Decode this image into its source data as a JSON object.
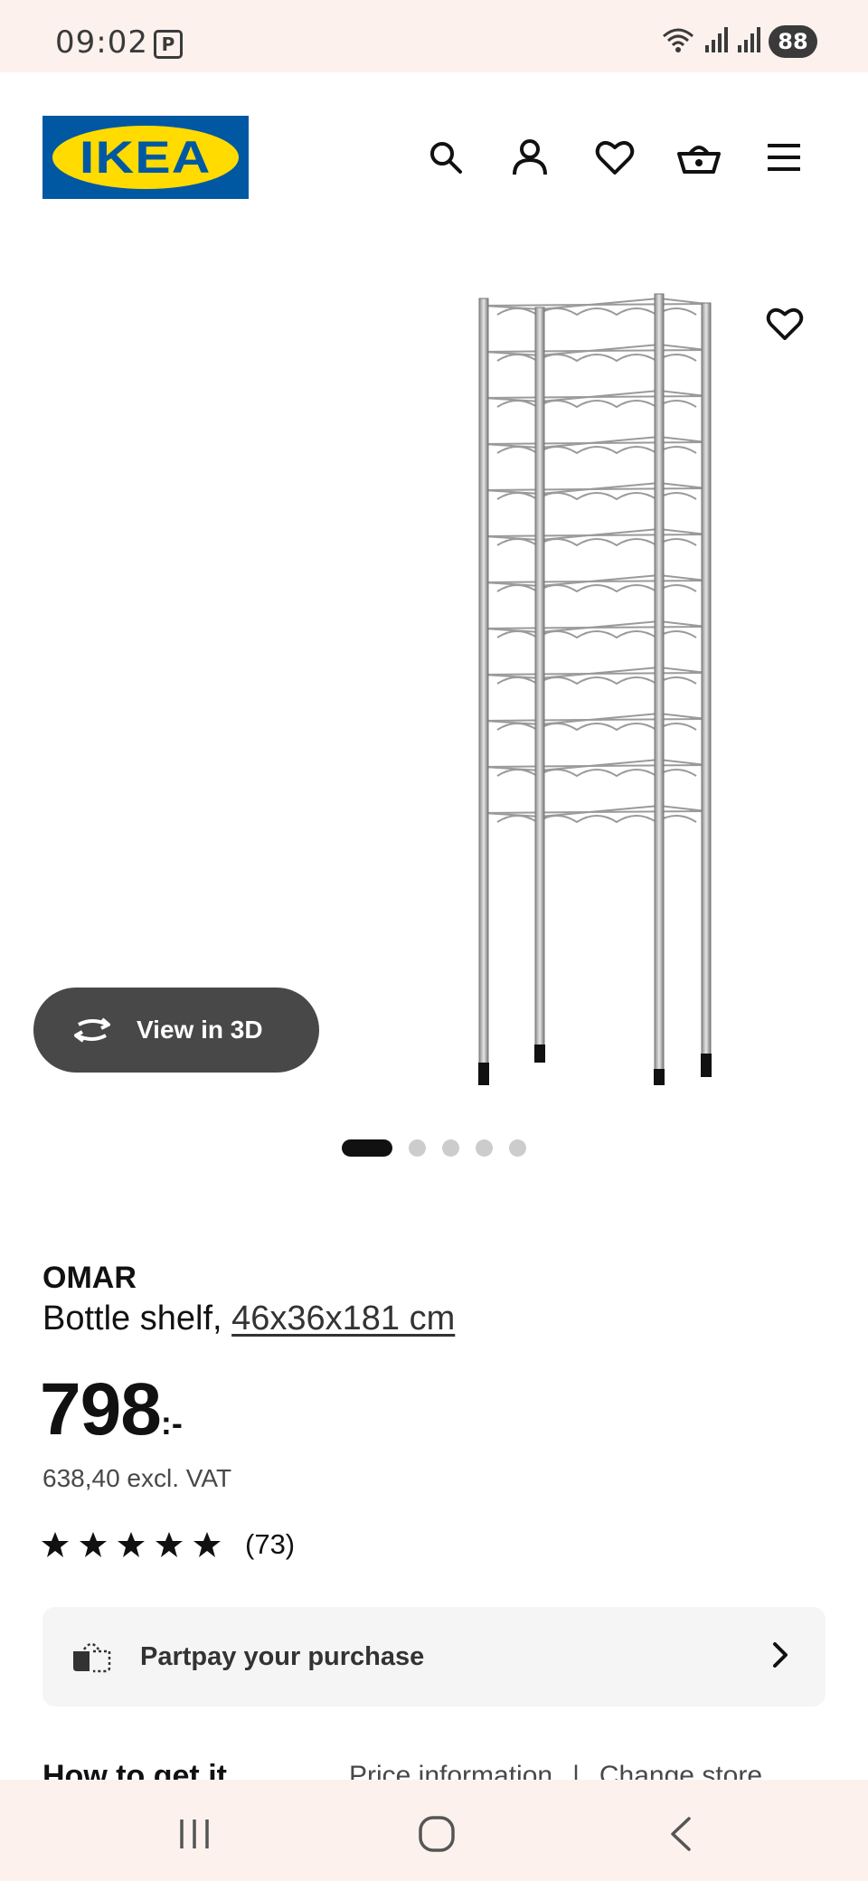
{
  "status_bar": {
    "time": "09:02",
    "parking_indicator": "P",
    "battery": "88",
    "icons": [
      "wifi-icon",
      "signal-icon",
      "signal-icon",
      "battery-icon"
    ]
  },
  "header": {
    "logo_text": "IKEA",
    "logo_colors": {
      "background": "#0058a3",
      "oval": "#ffdb00"
    },
    "icons": [
      "search-icon",
      "account-icon",
      "favourites-icon",
      "basket-icon",
      "menu-icon"
    ]
  },
  "gallery": {
    "view_3d_label": "View in 3D",
    "image_count": 5,
    "active_index": 0
  },
  "product": {
    "name": "OMAR",
    "type": "Bottle shelf, ",
    "dimensions": "46x36x181 cm",
    "price_main": "798",
    "price_suffix": ":-",
    "price_excl_vat": "638,40 excl. VAT",
    "rating_stars": 5,
    "review_count": "(73)"
  },
  "partpay": {
    "label": "Partpay your purchase"
  },
  "how_to_get_it": {
    "title": "How to get it",
    "price_information": "Price information",
    "separator": "|",
    "change_store": "Change store"
  },
  "nav_bar": {
    "icons": [
      "recent-apps-icon",
      "home-icon",
      "back-icon"
    ]
  },
  "colors": {
    "status_bar_bg": "#fdf1ee",
    "view_3d_bg": "#484848",
    "partpay_bg": "#f5f5f5"
  }
}
